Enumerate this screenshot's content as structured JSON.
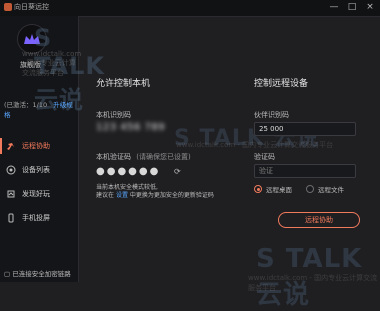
{
  "window": {
    "title": "向日葵远控",
    "controls": {
      "minimize": "—",
      "maximize": "□",
      "close": "×"
    }
  },
  "sidebar": {
    "avatar_label": "旗舰版",
    "license": {
      "text": "(已激活：1/10",
      "upgrade": "升级规格"
    },
    "items": [
      {
        "label": "远程协助",
        "icon": "remote-help-icon",
        "active": true
      },
      {
        "label": "设备列表",
        "icon": "device-list-icon",
        "active": false
      },
      {
        "label": "发现好玩",
        "icon": "discover-icon",
        "active": false
      },
      {
        "label": "手机投屏",
        "icon": "phone-mirror-icon",
        "active": false
      }
    ],
    "footer_status": "已连接安全加密链路"
  },
  "left_panel": {
    "title": "允许控制本机",
    "identify_label": "本机识别码",
    "identify_value": "123 456 789",
    "verify_label": "本机验证码",
    "verify_hint": "(请确保您已设置)",
    "verify_value": "●●●●●●",
    "note_line1": "当前本机安全模式较低,",
    "note_line2_pre": "建议在",
    "note_line2_link": "设置",
    "note_line2_post": "中更换为更加安全的更新验证码"
  },
  "right_panel": {
    "title": "控制远程设备",
    "partner_label": "伙伴识别码",
    "partner_value": "25        000",
    "verify_label": "验证码",
    "verify_placeholder": "验证",
    "mode_desktop": "远程桌面",
    "mode_file": "远程文件",
    "connect_button": "远程协助"
  },
  "watermarks": {
    "brand": "S TALK 云说",
    "url": "www.idctalk.com - 国内专业云计算交流服务平台"
  }
}
